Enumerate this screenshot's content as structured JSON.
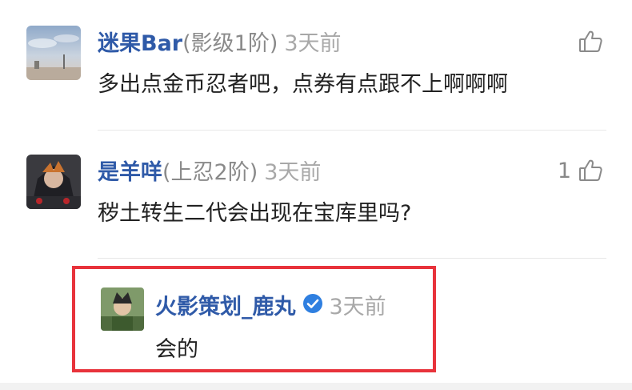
{
  "comments": [
    {
      "username": "迷果Bar",
      "level": "(影级1阶)",
      "time": "3天前",
      "text": "多出点金币忍者吧，点券有点跟不上啊啊啊",
      "likes": ""
    },
    {
      "username": "是羊咩",
      "level": "(上忍2阶)",
      "time": "3天前",
      "text": "秽土转生二代会出现在宝库里吗?",
      "likes": "1"
    }
  ],
  "reply": {
    "username": "火影策划_鹿丸",
    "time": "3天前",
    "text": "会的",
    "verified": true
  },
  "colors": {
    "username": "#2f5aa8",
    "highlight_border": "#e8333b",
    "verified_badge": "#2f7fe0"
  },
  "icons": {
    "like": "thumbs-up-icon",
    "verified": "verified-check-icon"
  }
}
